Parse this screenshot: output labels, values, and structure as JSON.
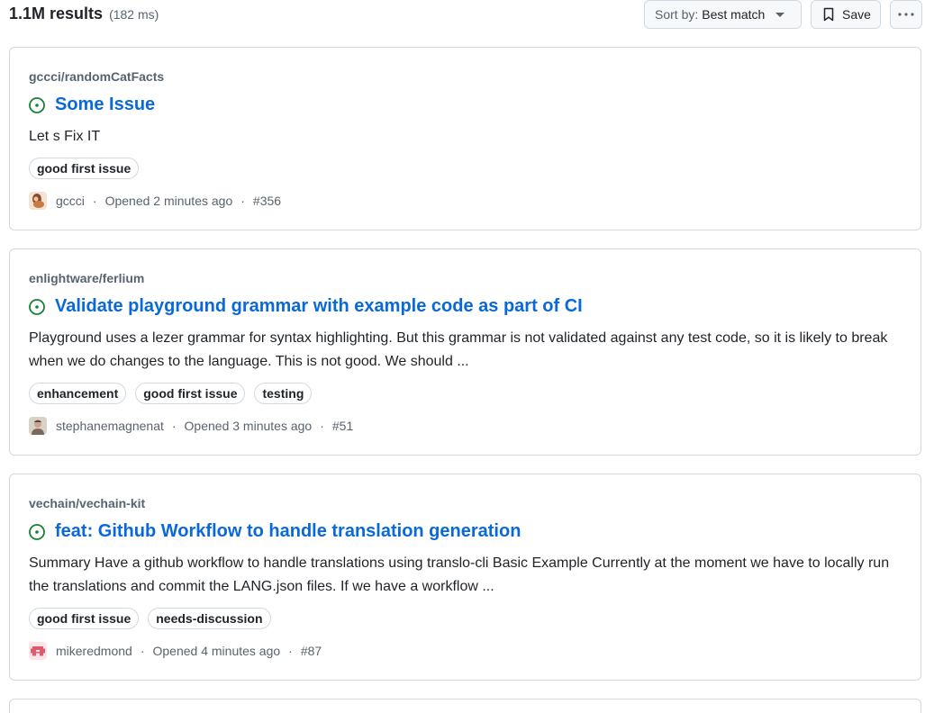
{
  "header": {
    "results_count": "1.1M results",
    "results_time": "(182 ms)",
    "sort_label": "Sort by:",
    "sort_value": "Best match",
    "save_label": "Save"
  },
  "colors": {
    "accent": "#0969da",
    "open_issue": "#1a7f37",
    "muted": "#59636e",
    "border": "#d1d9e0"
  },
  "results": [
    {
      "repo": "gccci/randomCatFacts",
      "title": "Some Issue",
      "body": "Let s Fix IT",
      "labels": [
        "good first issue"
      ],
      "author": "gccci",
      "opened": "Opened 2 minutes ago",
      "number": "#356",
      "state_icon": "issue-opened-icon"
    },
    {
      "repo": "enlightware/ferlium",
      "title": "Validate playground grammar with example code as part of CI",
      "body": "Playground uses a lezer grammar for syntax highlighting. But this grammar is not validated against any test code, so it is likely to break when we do changes to the language. This is not good. We should ...",
      "labels": [
        "enhancement",
        "good first issue",
        "testing"
      ],
      "author": "stephanemagnenat",
      "opened": "Opened 3 minutes ago",
      "number": "#51",
      "state_icon": "issue-opened-icon"
    },
    {
      "repo": "vechain/vechain-kit",
      "title": "feat: Github Workflow to handle translation generation",
      "body": "Summary Have a github workflow to handle translations using translo-cli Basic Example Currently at the moment we have to locally run the translations and commit the LANG.json files. If we have a workflow ...",
      "labels": [
        "good first issue",
        "needs-discussion"
      ],
      "author": "mikeredmond",
      "opened": "Opened 4 minutes ago",
      "number": "#87",
      "state_icon": "issue-opened-icon"
    }
  ]
}
